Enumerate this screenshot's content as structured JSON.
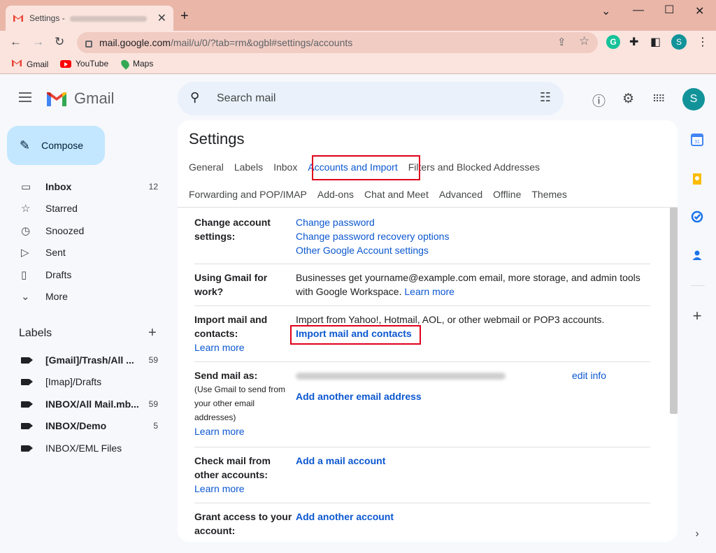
{
  "browser": {
    "tab_title": "Settings - ",
    "url_host": "mail.google.com",
    "url_path": "/mail/u/0/?tab=rm&ogbl#settings/accounts",
    "profile_initial": "S",
    "bookmarks": [
      "Gmail",
      "YouTube",
      "Maps"
    ]
  },
  "gmail": {
    "logo_text": "Gmail",
    "search_placeholder": "Search mail",
    "avatar_initial": "S"
  },
  "nav": {
    "compose": "Compose",
    "items": [
      {
        "label": "Inbox",
        "count": "12"
      },
      {
        "label": "Starred"
      },
      {
        "label": "Snoozed"
      },
      {
        "label": "Sent"
      },
      {
        "label": "Drafts"
      },
      {
        "label": "More"
      }
    ],
    "labels_header": "Labels",
    "labels": [
      {
        "label": "[Gmail]/Trash/All ...",
        "count": "59"
      },
      {
        "label": "[Imap]/Drafts"
      },
      {
        "label": "INBOX/All Mail.mb...",
        "count": "59"
      },
      {
        "label": "INBOX/Demo",
        "count": "5"
      },
      {
        "label": "INBOX/EML Files"
      }
    ]
  },
  "settings": {
    "title": "Settings",
    "tabs_row1": [
      "General",
      "Labels",
      "Inbox",
      "Accounts and Import",
      "Filters and Blocked Addresses"
    ],
    "tabs_row2": [
      "Forwarding and POP/IMAP",
      "Add-ons",
      "Chat and Meet",
      "Advanced",
      "Offline",
      "Themes"
    ],
    "rows": {
      "change_account": {
        "label": "Change account settings:",
        "links": [
          "Change password",
          "Change password recovery options",
          "Other Google Account settings"
        ]
      },
      "gmail_work": {
        "label": "Using Gmail for work?",
        "text": "Businesses get yourname@example.com email, more storage, and admin tools with Google Workspace.",
        "link": "Learn more"
      },
      "import": {
        "label": "Import mail and contacts:",
        "learn": "Learn more",
        "text": "Import from Yahoo!, Hotmail, AOL, or other webmail or POP3 accounts.",
        "action": "Import mail and contacts"
      },
      "send_as": {
        "label": "Send mail as:",
        "sub": "(Use Gmail to send from your other email addresses)",
        "learn": "Learn more",
        "edit": "edit info",
        "action": "Add another email address"
      },
      "check_mail": {
        "label": "Check mail from other accounts:",
        "learn": "Learn more",
        "action": "Add a mail account"
      },
      "grant": {
        "label": "Grant access to your account:",
        "action": "Add another account"
      }
    }
  }
}
